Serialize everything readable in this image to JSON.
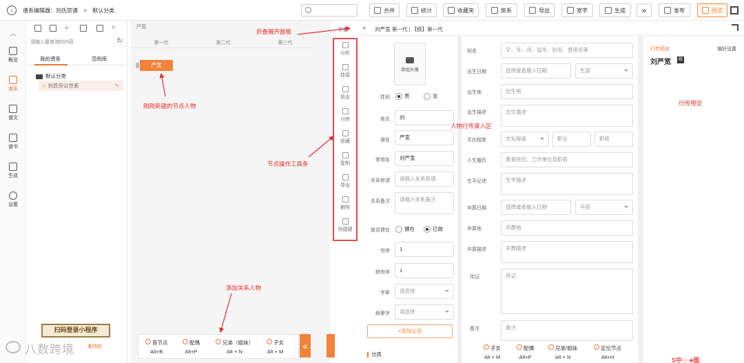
{
  "topbar": {
    "breadcrumb": [
      "谱系编辑器：刘氏宗谱",
      ">",
      "默认分类"
    ],
    "buttons": [
      "合并",
      "统计",
      "收藏夹",
      "房系",
      "导出",
      "室字",
      "生成",
      "发布",
      "预览"
    ]
  },
  "leftnav": {
    "items": [
      {
        "label": "",
        "icon": "chevron-up-icon"
      },
      {
        "label": "概览",
        "icon": "dashboard-icon"
      },
      {
        "label": "谱系",
        "icon": "tree-icon",
        "active": true
      },
      {
        "label": "谱文",
        "icon": "document-icon"
      },
      {
        "label": "谱书",
        "icon": "book-icon"
      },
      {
        "label": "生成",
        "icon": "send-icon"
      },
      {
        "label": "设置",
        "icon": "gear-icon"
      }
    ]
  },
  "genealogy": {
    "search_placeholder": "请输入要查询的内容",
    "tabs": [
      "我的谱系",
      "范例库"
    ],
    "category": "默认分类",
    "item": "刘氏宗公世系"
  },
  "footer_left": {
    "miniprogram": "扫码登录小程序",
    "watermark": "八数跨境",
    "privilege": "看特权"
  },
  "canvas": {
    "header": "严宽",
    "generations": [
      "第一代",
      "第二代",
      "第三代"
    ],
    "node_label": "严宽"
  },
  "node_toolbar": {
    "collapse_label": "折叠",
    "items": [
      "分析",
      "挂接",
      "拆支",
      "分房",
      "收藏",
      "复制",
      "导出",
      "删除",
      "快捷键"
    ]
  },
  "add_bar": {
    "items": [
      {
        "label": "首节点",
        "key": "Alt+B"
      },
      {
        "label": "配偶",
        "key": "Alt+P"
      },
      {
        "label": "兄弟（姐妹）",
        "key": "Alt + N"
      },
      {
        "label": "子女",
        "key": "Alt + M"
      }
    ]
  },
  "editor": {
    "title": "刘严宽·第一代 | 【统】第一代",
    "photo_label": "添加头像",
    "gender_label": "性别",
    "gender_male": "男",
    "gender_female": "女",
    "surname_label": "姓氏",
    "surname_value": "刘",
    "given_label": "谱名",
    "given_value": "严宽",
    "common_label": "常用名",
    "common_value": "刘严宽",
    "relation_label": "关系称谓",
    "relation_ph": "请输入关系称谓",
    "relation_note_label": "关系备注",
    "relation_note_ph": "请输入关系备注",
    "alive_label": "是否健在",
    "alive_yes": "健在",
    "alive_no": "已故",
    "gen_num_label": "世序",
    "gen_num_value": "1",
    "gen_order_label": "统世序",
    "gen_order_value": "1",
    "char_label": "字辈",
    "char_ph": "请选择",
    "char2_label": "统辈字",
    "char2_ph": "请选择",
    "add_father": "+添加父母",
    "branch": "分房",
    "alias_label": "别名",
    "alias_ph": "字、号、讳、谥号、别名、曾用名等",
    "birth_label": "出生日期",
    "birth_ph": "选择或者输入日期",
    "birth_zodiac": "生辰",
    "birthplace_label": "出生地",
    "birthplace_ph": "出生地",
    "birth_desc_label": "出生描述",
    "birth_desc_ph": "出生描述",
    "edu_label": "文化程度",
    "edu_ph": "文化程度",
    "job_ph": "职业",
    "title_ph": "职称",
    "career_label": "人生履历",
    "career_ph": "教育经历、工作单位及职务",
    "life_label": "生平记述",
    "life_ph": "生平描述",
    "death_label": "卒葬日期",
    "death_ph": "选择或者输入日期",
    "death_zodiac": "卒辰",
    "burial_label": "卒葬地",
    "burial_ph": "卒葬地",
    "burial_desc_label": "卒葬描述",
    "burial_desc_ph": "卒葬描述",
    "bio_label": "传记",
    "bio_ph": "传记",
    "note_label": "备注",
    "note_ph": "备注"
  },
  "add_bar2": {
    "items": [
      {
        "label": "子女",
        "key": "Alt + M"
      },
      {
        "label": "配偶",
        "key": "Alt+P"
      },
      {
        "label": "兄弟/姐妹",
        "key": "Alt + N"
      },
      {
        "label": "定位节点",
        "key": "Alt+H"
      }
    ]
  },
  "preview": {
    "tab": "行传预览",
    "settings": "偏好设置",
    "name": "刘严宽",
    "badge": "统",
    "bottom_logo": "S中·♪·♣图"
  },
  "annotations": {
    "collapse_panel": "折叠展开面板",
    "new_node": "刚刚新建的节点人物",
    "toolbar": "节点操作工具条",
    "entry": "人物行传录入区",
    "add_relation": "添加关系人物",
    "preview": "行传预览"
  }
}
